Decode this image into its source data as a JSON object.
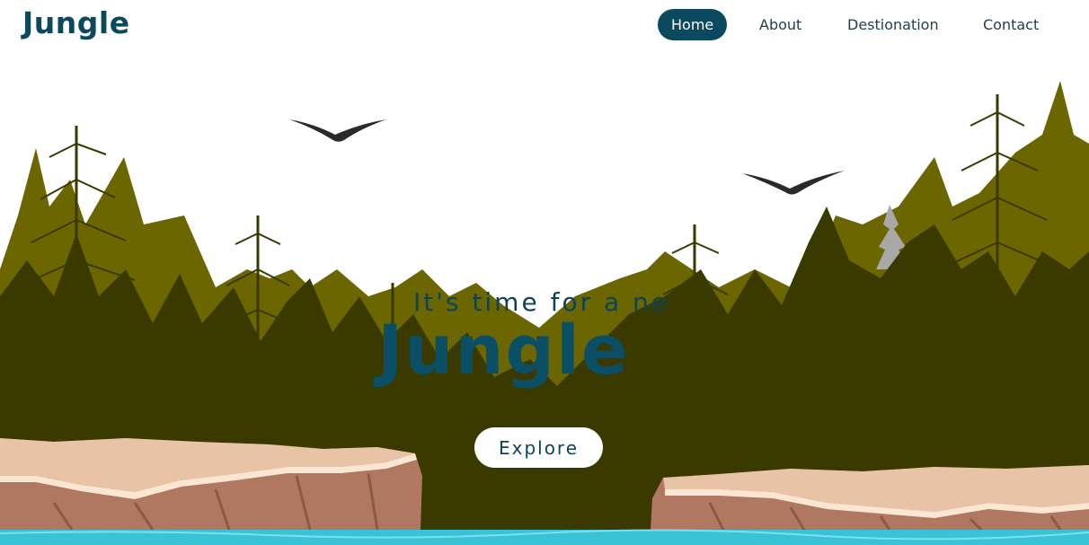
{
  "brand": {
    "logo_text": "Jungle"
  },
  "nav": {
    "items": [
      {
        "label": "Home",
        "active": true
      },
      {
        "label": "About",
        "active": false
      },
      {
        "label": "Destionation",
        "active": false
      },
      {
        "label": "Contact",
        "active": false
      }
    ]
  },
  "hero": {
    "subtitle": "It's time for a ne",
    "title": "Jungle",
    "cta_label": "Explore"
  },
  "colors": {
    "brand": "#0b4a5e",
    "forest_light": "#6b6600",
    "forest_dark": "#3a3a00",
    "cliff": "#c9937c",
    "water": "#39c3d4"
  }
}
